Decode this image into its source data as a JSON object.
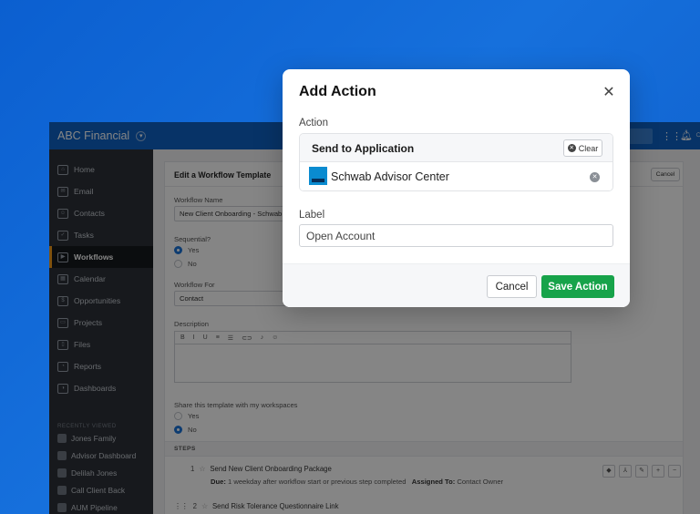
{
  "app": {
    "brand": "ABC Financial",
    "brand_chevron_icon": "chevron-down-icon",
    "header_icons": [
      "grid-icon",
      "bell-icon",
      "more-icon"
    ]
  },
  "sidebar": {
    "items": [
      {
        "label": "Home",
        "icon": "home-icon"
      },
      {
        "label": "Email",
        "icon": "mail-icon"
      },
      {
        "label": "Contacts",
        "icon": "people-icon"
      },
      {
        "label": "Tasks",
        "icon": "checkbox-icon"
      },
      {
        "label": "Workflows",
        "icon": "play-icon",
        "active": true
      },
      {
        "label": "Calendar",
        "icon": "calendar-icon"
      },
      {
        "label": "Opportunities",
        "icon": "dollar-icon"
      },
      {
        "label": "Projects",
        "icon": "briefcase-icon"
      },
      {
        "label": "Files",
        "icon": "file-icon"
      },
      {
        "label": "Reports",
        "icon": "pie-chart-icon"
      },
      {
        "label": "Dashboards",
        "icon": "gauge-icon"
      }
    ],
    "recent_title": "RECENTLY VIEWED",
    "recent": [
      "Jones Family",
      "Advisor Dashboard",
      "Delilah Jones",
      "Call Client Back",
      "AUM Pipeline"
    ]
  },
  "form": {
    "title": "Edit a Workflow Template",
    "cancel_label": "Cancel",
    "workflow_name_label": "Workflow Name",
    "workflow_name_value": "New Client Onboarding - Schwab",
    "sequential_label": "Sequential?",
    "sequential_yes": "Yes",
    "sequential_no": "No",
    "workflow_for_label": "Workflow For",
    "workflow_for_value": "Contact",
    "description_label": "Description",
    "editor_tools": [
      "B",
      "I",
      "U",
      "≡",
      "☰",
      "⊂⊃",
      "♪",
      "☺"
    ],
    "share_label": "Share this template with my workspaces",
    "share_yes": "Yes",
    "share_no": "No",
    "steps_title": "STEPS",
    "step1_num": "1",
    "step1_title": "Send New Client Onboarding Package",
    "step1_due_label": "Due:",
    "step1_due_value": "1 weekday after workflow start or previous step completed",
    "step1_assigned_label": "Assigned To:",
    "step1_assigned_value": "Contact Owner",
    "step2_num": "2",
    "step2_title": "Send Risk Tolerance Questionnaire Link",
    "step_tool_icons": [
      "tag-icon",
      "branch-icon",
      "edit-icon",
      "plus-icon",
      "minus-icon"
    ]
  },
  "modal": {
    "title": "Add Action",
    "close_icon": "close-icon",
    "action_label": "Action",
    "action_name": "Send to Application",
    "clear_label": "Clear",
    "application_name": "Schwab Advisor Center",
    "label_label": "Label",
    "label_value": "Open Account",
    "cancel_label": "Cancel",
    "save_label": "Save Action",
    "save_color": "#17a34a"
  }
}
